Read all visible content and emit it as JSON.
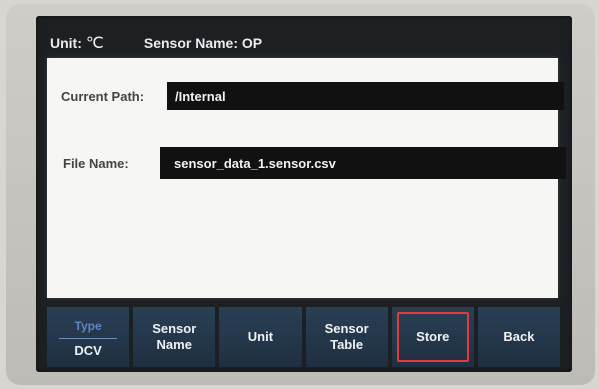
{
  "titlebar": {
    "unit_label": "Unit:",
    "unit_value": "℃",
    "sensor_name": "Sensor Name: OP"
  },
  "form": {
    "current_path_label": "Current Path:",
    "current_path_value": "/Internal",
    "file_name_label": "File Name:",
    "file_name_value": "sensor_data_1.sensor.csv"
  },
  "softkeys": {
    "type_label": "Type",
    "type_value": "DCV",
    "sensor_name_line1": "Sensor",
    "sensor_name_line2": "Name",
    "unit": "Unit",
    "sensor_table_line1": "Sensor",
    "sensor_table_line2": "Table",
    "store": "Store",
    "back": "Back"
  },
  "colors": {
    "softkey_bg": "#1f2f40",
    "highlight": "#e23b3b",
    "field_bg": "#111111"
  }
}
